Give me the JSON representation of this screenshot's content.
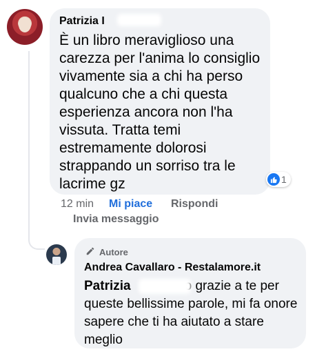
{
  "comment": {
    "author_prefix": "Patrizia I",
    "text": "È un libro meraviglioso una carezza per l'anima lo consiglio vivamente sia a chi ha perso qualcuno che a chi questa esperienza ancora non l'ha vissuta. Tratta temi estremamente dolorosi strappando un sorriso tra le lacrime gz",
    "reactions": {
      "icon": "like-icon",
      "count": "1",
      "color": "#1877f2"
    },
    "actions": {
      "time": "12 min",
      "like": "Mi piace",
      "reply": "Rispondi",
      "send_message": "Invia messaggio"
    }
  },
  "reply": {
    "badge": "Autore",
    "badge_icon": "pencil-icon",
    "author": "Andrea Cavallaro - Restalamore.it",
    "mention_prefix": "Patrizia",
    "text_after_mention": "o grazie a te per queste bellissime parole, mi fa onore sapere che ti ha aiutato a stare meglio"
  },
  "colors": {
    "bubble": "#f0f2f5",
    "link": "#216fdb",
    "secondary_text": "#65676b"
  }
}
